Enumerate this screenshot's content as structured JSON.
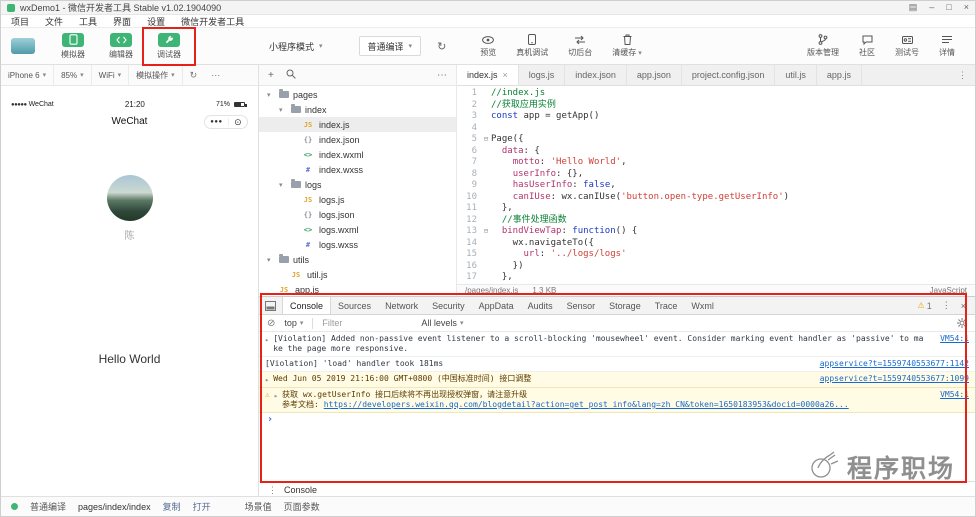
{
  "window": {
    "title": "wxDemo1 - 微信开发者工具 Stable v1.02.1904090",
    "menu": [
      "项目",
      "文件",
      "工具",
      "界面",
      "设置",
      "微信开发者工具"
    ]
  },
  "icons": {
    "caret": "▾",
    "close": "×",
    "minimize": "–",
    "maximize": "□",
    "feedback": "▤",
    "kebab": "⋮",
    "more": "⋯",
    "warning": "⚠",
    "expand": "▸",
    "prompt": "›",
    "clear": "⊘",
    "refresh": "↻",
    "add": "+",
    "fold": "⊟",
    "capsule_more": "●●●",
    "capsule_target": "⊙"
  },
  "toolbar": {
    "toggles": [
      {
        "label": "模拟器",
        "icon": "simulator-icon"
      },
      {
        "label": "编辑器",
        "icon": "editor-icon"
      },
      {
        "label": "调试器",
        "icon": "debugger-icon"
      }
    ],
    "mode_select": "小程序模式",
    "compile_select": "普通编译",
    "actions": [
      {
        "label": "预览",
        "icon": "preview-icon"
      },
      {
        "label": "真机调试",
        "icon": "realdevice-icon"
      },
      {
        "label": "切后台",
        "icon": "background-icon"
      },
      {
        "label": "清缓存",
        "icon": "cache-icon",
        "caret": true
      }
    ],
    "right_actions": [
      {
        "label": "版本管理",
        "icon": "version-icon"
      },
      {
        "label": "社区",
        "icon": "community-icon"
      },
      {
        "label": "测试号",
        "icon": "testaccount-icon"
      },
      {
        "label": "详情",
        "icon": "detail-icon"
      }
    ]
  },
  "simulator": {
    "controls": [
      "iPhone 6",
      "85%",
      "WiFi",
      "模拟操作"
    ],
    "phone": {
      "carrier_dots": "●●●●●",
      "carrier": "WeChat",
      "time": "21:20",
      "battery": "71%",
      "nav_title": "WeChat",
      "user_name": "陈",
      "motto": "Hello World"
    }
  },
  "filetree": {
    "items": [
      {
        "type": "folder",
        "label": "pages",
        "depth": 0
      },
      {
        "type": "folder",
        "label": "index",
        "depth": 1
      },
      {
        "type": "file",
        "ext": "js",
        "label": "index.js",
        "depth": 2,
        "active": true
      },
      {
        "type": "file",
        "ext": "json",
        "label": "index.json",
        "depth": 2
      },
      {
        "type": "file",
        "ext": "wxml",
        "label": "index.wxml",
        "depth": 2
      },
      {
        "type": "file",
        "ext": "wxss",
        "label": "index.wxss",
        "depth": 2
      },
      {
        "type": "folder",
        "label": "logs",
        "depth": 1
      },
      {
        "type": "file",
        "ext": "js",
        "label": "logs.js",
        "depth": 2
      },
      {
        "type": "file",
        "ext": "json",
        "label": "logs.json",
        "depth": 2
      },
      {
        "type": "file",
        "ext": "wxml",
        "label": "logs.wxml",
        "depth": 2
      },
      {
        "type": "file",
        "ext": "wxss",
        "label": "logs.wxss",
        "depth": 2
      },
      {
        "type": "folder",
        "label": "utils",
        "depth": 0
      },
      {
        "type": "file",
        "ext": "js",
        "label": "util.js",
        "depth": 1
      },
      {
        "type": "file",
        "ext": "js",
        "label": "app.js",
        "depth": 0
      }
    ]
  },
  "editor": {
    "tabs": [
      {
        "label": "index.js",
        "active": true,
        "closable": true
      },
      {
        "label": "logs.js"
      },
      {
        "label": "index.json"
      },
      {
        "label": "app.json"
      },
      {
        "label": "project.config.json"
      },
      {
        "label": "util.js"
      },
      {
        "label": "app.js"
      }
    ],
    "status": {
      "path": "/pages/index.js",
      "size": "1.3 KB",
      "language": "JavaScript"
    },
    "code_lines": [
      {
        "n": 1,
        "tokens": [
          {
            "t": "//index.js",
            "c": "cmt"
          }
        ]
      },
      {
        "n": 2,
        "tokens": [
          {
            "t": "//获取应用实例",
            "c": "cmt"
          }
        ]
      },
      {
        "n": 3,
        "tokens": [
          {
            "t": "const",
            "c": "kw"
          },
          {
            "t": " app = getApp()",
            "c": "pl"
          }
        ]
      },
      {
        "n": 4,
        "tokens": []
      },
      {
        "n": 5,
        "fold": true,
        "tokens": [
          {
            "t": "Page({",
            "c": "pl"
          }
        ]
      },
      {
        "n": 6,
        "tokens": [
          {
            "t": "  ",
            "c": "pl"
          },
          {
            "t": "data",
            "c": "pr"
          },
          {
            "t": ": {",
            "c": "pl"
          }
        ]
      },
      {
        "n": 7,
        "tokens": [
          {
            "t": "    ",
            "c": "pl"
          },
          {
            "t": "motto",
            "c": "pr"
          },
          {
            "t": ": ",
            "c": "pl"
          },
          {
            "t": "'Hello World'",
            "c": "str"
          },
          {
            "t": ",",
            "c": "pl"
          }
        ]
      },
      {
        "n": 8,
        "tokens": [
          {
            "t": "    ",
            "c": "pl"
          },
          {
            "t": "userInfo",
            "c": "pr"
          },
          {
            "t": ": {},",
            "c": "pl"
          }
        ]
      },
      {
        "n": 9,
        "tokens": [
          {
            "t": "    ",
            "c": "pl"
          },
          {
            "t": "hasUserInfo",
            "c": "pr"
          },
          {
            "t": ": ",
            "c": "pl"
          },
          {
            "t": "false",
            "c": "kw"
          },
          {
            "t": ",",
            "c": "pl"
          }
        ]
      },
      {
        "n": 10,
        "tokens": [
          {
            "t": "    ",
            "c": "pl"
          },
          {
            "t": "canIUse",
            "c": "pr"
          },
          {
            "t": ": wx.canIUse(",
            "c": "pl"
          },
          {
            "t": "'button.open-type.getUserInfo'",
            "c": "str"
          },
          {
            "t": ")",
            "c": "pl"
          }
        ]
      },
      {
        "n": 11,
        "tokens": [
          {
            "t": "  },",
            "c": "pl"
          }
        ]
      },
      {
        "n": 12,
        "tokens": [
          {
            "t": "  //事件处理函数",
            "c": "cmt"
          }
        ]
      },
      {
        "n": 13,
        "fold": true,
        "tokens": [
          {
            "t": "  ",
            "c": "pl"
          },
          {
            "t": "bindViewTap",
            "c": "pr"
          },
          {
            "t": ": ",
            "c": "pl"
          },
          {
            "t": "function",
            "c": "kw"
          },
          {
            "t": "() {",
            "c": "pl"
          }
        ]
      },
      {
        "n": 14,
        "tokens": [
          {
            "t": "    wx.navigateTo({",
            "c": "pl"
          }
        ]
      },
      {
        "n": 15,
        "tokens": [
          {
            "t": "      ",
            "c": "pl"
          },
          {
            "t": "url",
            "c": "pr"
          },
          {
            "t": ": ",
            "c": "pl"
          },
          {
            "t": "'../logs/logs'",
            "c": "str"
          }
        ]
      },
      {
        "n": 16,
        "tokens": [
          {
            "t": "    })",
            "c": "pl"
          }
        ]
      },
      {
        "n": 17,
        "tokens": [
          {
            "t": "  },",
            "c": "pl"
          }
        ]
      }
    ]
  },
  "debugger": {
    "tabs": [
      "Console",
      "Sources",
      "Network",
      "Security",
      "AppData",
      "Audits",
      "Sensor",
      "Storage",
      "Trace",
      "Wxml"
    ],
    "active_tab": "Console",
    "warn_count": "1",
    "toolbar": {
      "context": "top",
      "filter_placeholder": "Filter",
      "levels": "All levels"
    },
    "messages": [
      {
        "expand": true,
        "bg": "white",
        "text": "[Violation] Added non-passive event listener to a scroll-blocking 'mousewheel' event. Consider marking event handler as 'passive' to make the page more responsive.",
        "source": "VM54:1"
      },
      {
        "bg": "white",
        "text": "[Violation] 'load' handler took 181ms",
        "source": "appservice?t=1559740553677:1142"
      },
      {
        "expand": true,
        "bg": "warn",
        "text": "Wed Jun 05 2019 21:16:00 GMT+0800 (中国标准时间) 接口调整",
        "source": "appservice?t=1559740553677:1099"
      },
      {
        "expand": true,
        "bg": "warn",
        "warn_icon": true,
        "text": "获取 wx.getUserInfo 接口后续将不再出现授权弹窗，请注意升级",
        "line2_prefix": "参考文档: ",
        "line2_link": "https://developers.weixin.qq.com/blogdetail?action=get_post_info&lang=zh_CN&token=1650183953&docid=0000a26...",
        "source": "VM54:1"
      }
    ],
    "footer_tab": "Console"
  },
  "statusbar": {
    "compile_mode": "普通编译",
    "page_path": "pages/index/index",
    "copy_label": "复制",
    "open_label": "打开",
    "scene_label": "场景值",
    "params_label": "页面参数"
  },
  "watermark": "程序职场",
  "colors": {
    "accent_green": "#3eb575",
    "warn_bg": "#fffbe5",
    "link_blue": "#1769cf",
    "annotation_red": "#e62117"
  }
}
